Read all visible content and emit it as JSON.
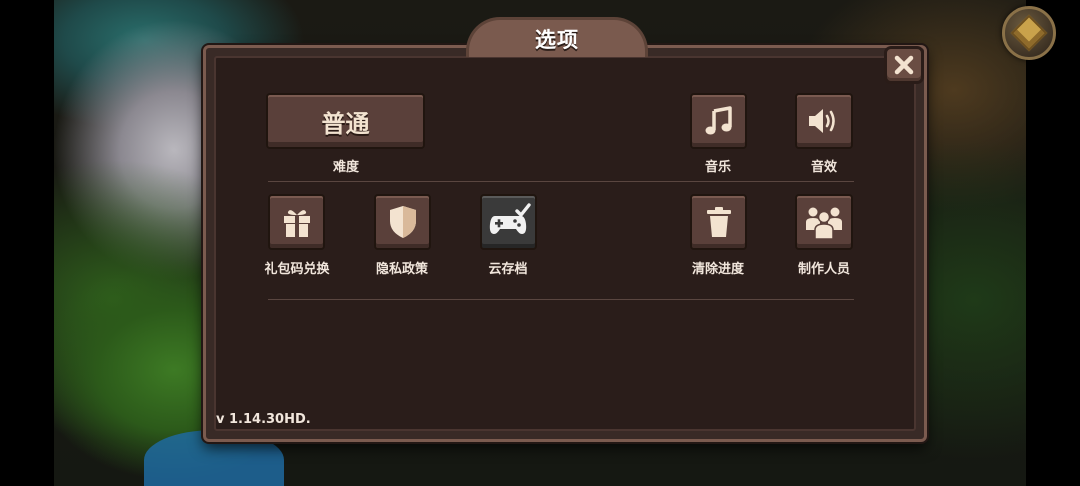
{
  "dialog": {
    "title": "选项",
    "version": "v 1.14.30HD."
  },
  "difficulty": {
    "value": "普通",
    "label": "难度"
  },
  "audio": {
    "music_label": "音乐",
    "sound_label": "音效"
  },
  "options": [
    {
      "label": "礼包码兑换",
      "icon": "gift-icon"
    },
    {
      "label": "隐私政策",
      "icon": "shield-icon"
    },
    {
      "label": "云存档",
      "icon": "gamepad-icon"
    },
    {
      "label": "清除进度",
      "icon": "trash-icon"
    },
    {
      "label": "制作人员",
      "icon": "people-icon"
    }
  ],
  "colors": {
    "panel": "#392a26",
    "panel_inner": "#2a1d1a",
    "button": "#5a403a",
    "button_dark": "#3a3a3a",
    "text": "#f1e6dc",
    "icon": "#f3e3d0"
  }
}
